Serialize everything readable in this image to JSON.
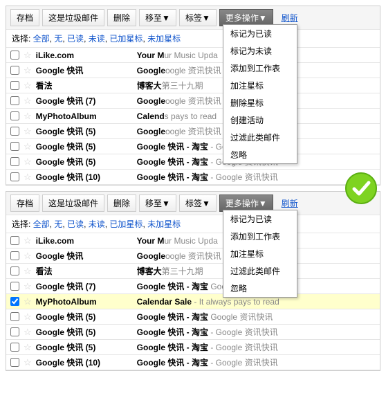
{
  "toolbar": {
    "archive": "存档",
    "spam": "这是垃圾邮件",
    "delete": "删除",
    "move": "移至▼",
    "labels": "标签▼",
    "more": "更多操作▼",
    "refresh": "刷新"
  },
  "select": {
    "label": "选择: ",
    "all": "全部",
    "none": "无",
    "read": "已读",
    "unread": "未读",
    "starred": "已加星标",
    "unstarred": "未加星标"
  },
  "menuA": [
    "标记为已读",
    "标记为未读",
    "添加到工作表",
    "加注星标",
    "删除星标",
    "创建活动",
    "过滤此类邮件",
    "忽略"
  ],
  "menuB": [
    "标记为已读",
    "添加到工作表",
    "加注星标",
    "过滤此类邮件",
    "忽略"
  ],
  "rows": [
    {
      "sender": "iLike.com",
      "subj": "Your M",
      "tail": "ur Music Upda"
    },
    {
      "sender": "Google 快讯",
      "subj": "Google",
      "tail": "oogle 资讯快讯"
    },
    {
      "sender": "看法",
      "subj": "博客大",
      "tail": "第三十九期"
    },
    {
      "sender": "Google 快讯 (7)",
      "subj": "Google",
      "tail": "oogle 资讯快讯"
    },
    {
      "sender": "MyPhotoAlbum",
      "subj": "Calend",
      "tail": "s pays to read"
    },
    {
      "sender": "Google 快讯 (5)",
      "subj": "Google",
      "tail": "oogle 资讯快讯"
    },
    {
      "sender": "Google 快讯 (5)",
      "subj": "Google 快讯 - 淘宝",
      "tail": " - Google 资讯快讯"
    },
    {
      "sender": "Google 快讯 (5)",
      "subj": "Google 快讯 - 淘宝",
      "tail": " - Google 资讯快讯"
    },
    {
      "sender": "Google 快讯 (10)",
      "subj": "Google 快讯 - 淘宝",
      "tail": " - Google 资讯快讯"
    }
  ],
  "rowsB": [
    {
      "sender": "iLike.com",
      "subj": "Your M",
      "tail": "ur Music Upda",
      "sel": false
    },
    {
      "sender": "Google 快讯",
      "subj": "Google",
      "tail": "oogle 资讯快讯",
      "sel": false
    },
    {
      "sender": "看法",
      "subj": "博客大",
      "tail": "第三十九期",
      "sel": false
    },
    {
      "sender": "Google 快讯 (7)",
      "subj": "Google 快讯 - 淘宝",
      "tail": " Google 资讯快讯",
      "sel": false
    },
    {
      "sender": "MyPhotoAlbum",
      "subj": "Calendar Sale",
      "tail": " - It always pays to read",
      "sel": true
    },
    {
      "sender": "Google 快讯 (5)",
      "subj": "Google 快讯 - 淘宝",
      "tail": " Google 资讯快讯",
      "sel": false
    },
    {
      "sender": "Google 快讯 (5)",
      "subj": "Google 快讯 - 淘宝",
      "tail": " - Google 资讯快讯",
      "sel": false
    },
    {
      "sender": "Google 快讯 (5)",
      "subj": "Google 快讯 - 淘宝",
      "tail": " - Google 资讯快讯",
      "sel": false
    },
    {
      "sender": "Google 快讯 (10)",
      "subj": "Google 快讯 - 淘宝",
      "tail": " - Google 资讯快讯",
      "sel": false
    }
  ],
  "sep": ", "
}
